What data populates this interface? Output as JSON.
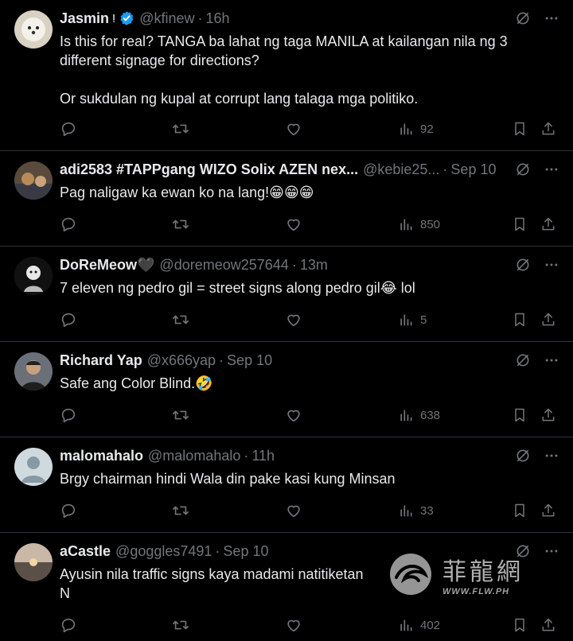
{
  "posts": [
    {
      "name": "Jasmin",
      "name_suffix": "ⵑ",
      "verified": true,
      "handle": "@kfinew",
      "time": "16h",
      "text": "Is this for real? TANGA ba lahat ng taga MANILA at kailangan nila ng 3 different signage for directions?\n\nOr sukdulan ng kupal at corrupt lang talaga mga politiko.",
      "views": "92"
    },
    {
      "name": "adi2583 #TAPPgang WIZO Solix AZEN nex...",
      "handle": "@kebie25...",
      "time": "Sep 10",
      "text": "Pag naligaw ka ewan ko na lang!😁😁😁",
      "views": "850"
    },
    {
      "name": "DoReMeow🖤",
      "handle": "@doremeow257644",
      "time": "13m",
      "text": "7 eleven ng pedro gil = street signs along pedro gil😂 lol",
      "views": "5"
    },
    {
      "name": "Richard Yap",
      "handle": "@x666yap",
      "time": "Sep 10",
      "text": "Safe ang Color Blind.🤣",
      "views": "638"
    },
    {
      "name": "malomahalo",
      "handle": "@malomahalo",
      "time": "11h",
      "text": "Brgy chairman hindi Wala din pake kasi kung Minsan",
      "views": "33"
    },
    {
      "name": "aCastle",
      "handle": "@goggles7491",
      "time": "Sep 10",
      "text": "Ayusin nila traffic signs kaya madami natitiketan\nN",
      "views": "402"
    }
  ],
  "watermark": {
    "text": "菲龍網",
    "url": "WWW.FLW.PH"
  },
  "colors": {
    "background": "#000000",
    "text": "#e7e9ea",
    "muted": "#71767b",
    "divider": "#2f3336",
    "verified": "#1d9bf0"
  }
}
